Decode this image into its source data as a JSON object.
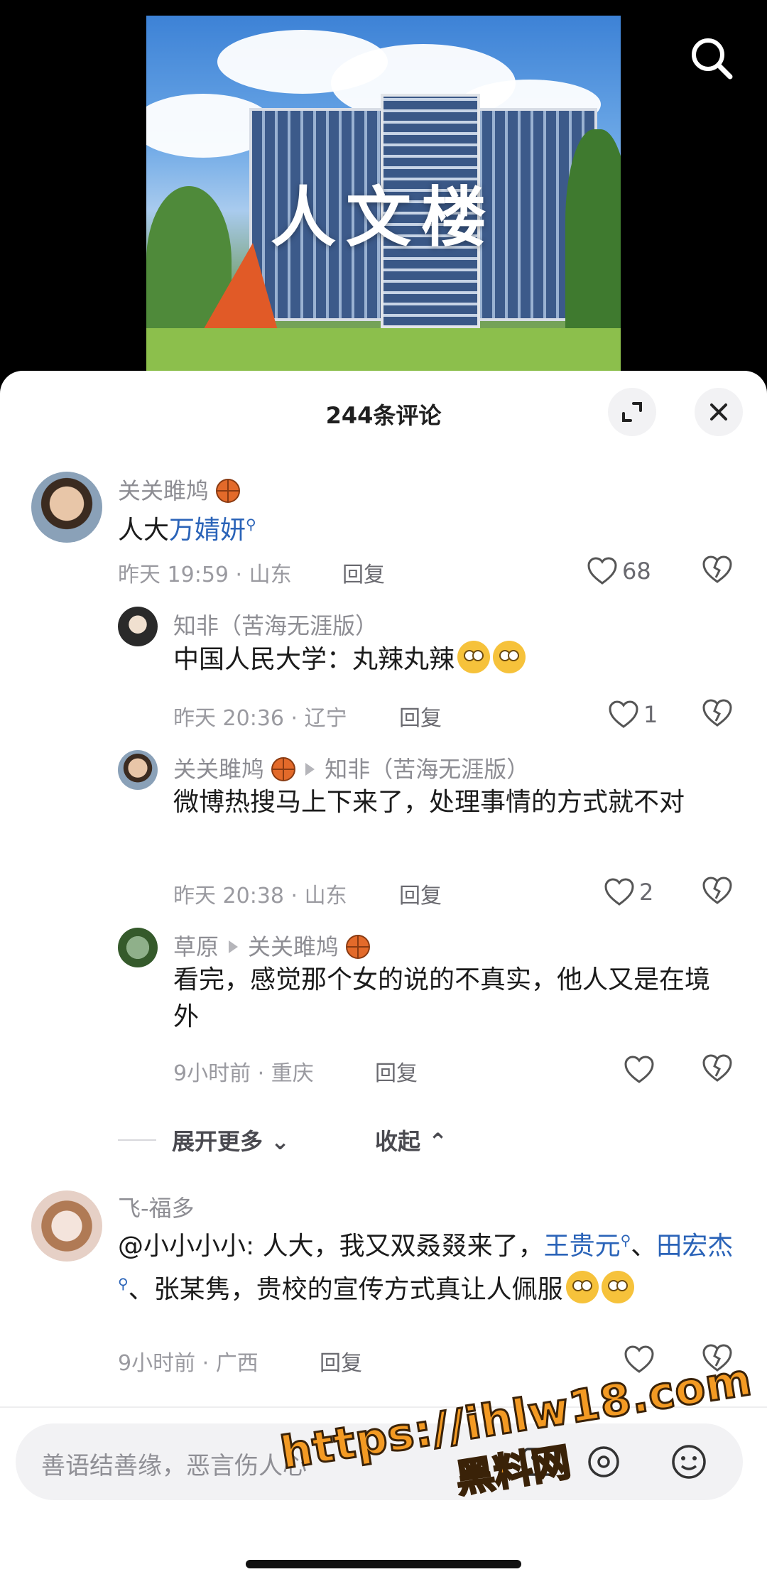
{
  "video": {
    "overlay_title": "人文楼",
    "search_icon": "search-icon"
  },
  "sheet": {
    "title": "244条评论",
    "expand_icon": "expand-icon",
    "close_icon": "close-icon"
  },
  "comments": [
    {
      "name": "关关雎鸠",
      "text_prefix": "人大",
      "text_link": "万婧妍",
      "meta": "昨天 19:59 · 山东",
      "reply": "回复",
      "likes": "68"
    },
    {
      "name": "知非（苦海无涯版）",
      "text": "中国人民大学：丸辣丸辣",
      "meta": "昨天 20:36 · 辽宁",
      "reply": "回复",
      "likes": "1"
    },
    {
      "name": "关关雎鸠",
      "reply_to": "知非（苦海无涯版）",
      "text": "微博热搜马上下来了，处理事情的方式就不对",
      "meta": "昨天 20:38 · 山东",
      "reply": "回复",
      "likes": "2"
    },
    {
      "name": "草原",
      "reply_to": "关关雎鸠",
      "text": "看完，感觉那个女的说的不真实，他人又是在境外",
      "meta": "9小时前 · 重庆",
      "reply": "回复",
      "likes": ""
    },
    {
      "name": "飞-福多",
      "text_a": "@小小小小: 人大，我又双叒叕来了，",
      "link_1": "王贵元",
      "sep": "、",
      "link_2": "田宏杰",
      "text_b": "、张某隽，贵校的宣传方式真让人佩服",
      "meta": "9小时前 · 广西",
      "reply": "回复",
      "likes": ""
    }
  ],
  "expand": {
    "more": "展开更多",
    "collapse": "收起"
  },
  "input": {
    "placeholder": "善语结善缘，恶言伤人心"
  },
  "watermark": {
    "url": "https://ihlw18.com",
    "label": "黑料网"
  },
  "colors": {
    "link": "#2a63b8",
    "watermark": "#f39a23"
  }
}
